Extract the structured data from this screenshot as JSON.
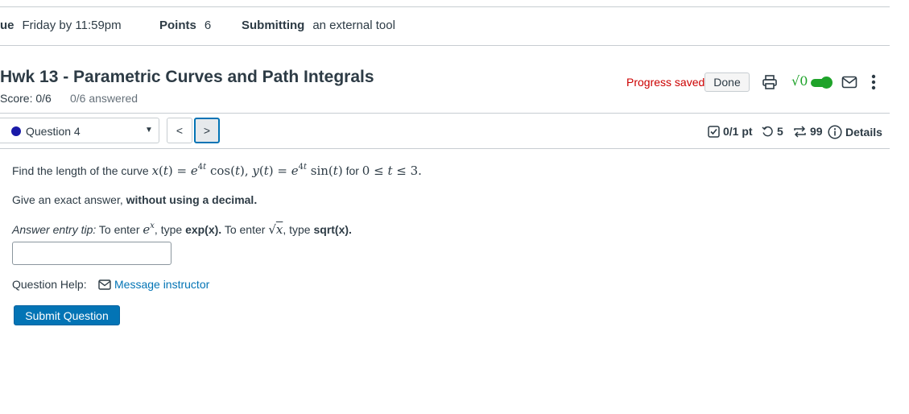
{
  "assignment_meta": {
    "due_label": "ue",
    "due_value": "Friday by 11:59pm",
    "points_label": "Points",
    "points_value": "6",
    "submitting_label": "Submitting",
    "submitting_value": "an external tool"
  },
  "header": {
    "title": "Hwk 13 - Parametric Curves and Path Integrals",
    "score": "Score: 0/6",
    "answered": "0/6 answered",
    "progress_status": "Progress saved",
    "done_label": "Done",
    "sqrt_toggle_label": "√0",
    "sqrt_toggle_on": true
  },
  "question_nav": {
    "selected_question": "Question 4",
    "prev_symbol": "<",
    "next_symbol": ">",
    "status_dot_color": "#1a1aa8"
  },
  "question_stats": {
    "points": "0/1 pt",
    "retries": "5",
    "attempts": "99",
    "details_label": "Details"
  },
  "question": {
    "prompt_prefix": "Find the length of the curve",
    "prompt_for": "for",
    "instruction_prefix": "Give an exact answer,",
    "instruction_bold": "without using a decimal.",
    "tip_label": "Answer entry tip:",
    "tip_part1": "To enter",
    "tip_type1": ", type",
    "tip_code1": "exp(x).",
    "tip_part2": "To enter",
    "tip_type2": ", type",
    "tip_code2": "sqrt(x).",
    "answer_value": "",
    "help_label": "Question Help:",
    "message_instructor": "Message instructor",
    "submit_label": "Submit Question"
  },
  "colors": {
    "accent_blue": "#0374b5",
    "progress_red": "#cc0000",
    "toggle_green": "#1fa32a"
  }
}
